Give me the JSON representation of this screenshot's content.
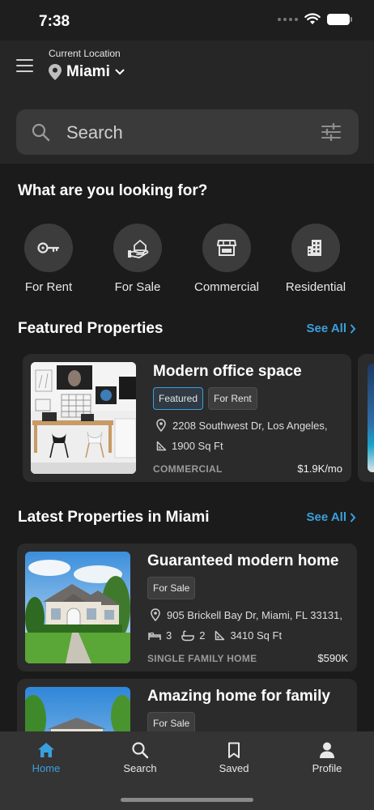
{
  "status": {
    "time": "7:38"
  },
  "header": {
    "location_label": "Current Location",
    "city": "Miami",
    "search_placeholder": "Search"
  },
  "categories": {
    "title": "What are you looking for?",
    "items": [
      {
        "label": "For Rent",
        "icon": "key-icon"
      },
      {
        "label": "For Sale",
        "icon": "hand-house-icon"
      },
      {
        "label": "Commercial",
        "icon": "storefront-icon"
      },
      {
        "label": "Residential",
        "icon": "building-icon"
      }
    ]
  },
  "featured": {
    "title": "Featured Properties",
    "see_all": "See All",
    "cards": [
      {
        "title": "Modern office space",
        "badges": [
          "Featured",
          "For Rent"
        ],
        "address": "2208 Southwest Dr, Los Angeles,",
        "area": "1900 Sq Ft",
        "type": "COMMERCIAL",
        "price": "$1.9K/mo"
      }
    ]
  },
  "latest": {
    "title": "Latest Properties in Miami",
    "see_all": "See All",
    "cards": [
      {
        "title": "Guaranteed modern home",
        "badges": [
          "For Sale"
        ],
        "address": "905 Brickell Bay Dr, Miami, FL 33131,",
        "beds": "3",
        "baths": "2",
        "area": "3410 Sq Ft",
        "type": "SINGLE FAMILY HOME",
        "price": "$590K"
      },
      {
        "title": "Amazing home for family",
        "badges": [
          "For Sale"
        ]
      }
    ]
  },
  "tabbar": {
    "items": [
      {
        "label": "Home",
        "active": true
      },
      {
        "label": "Search",
        "active": false
      },
      {
        "label": "Saved",
        "active": false
      },
      {
        "label": "Profile",
        "active": false
      }
    ]
  },
  "colors": {
    "accent": "#3aa0dd",
    "background": "#1b1b1b",
    "card": "#2b2b2b"
  }
}
